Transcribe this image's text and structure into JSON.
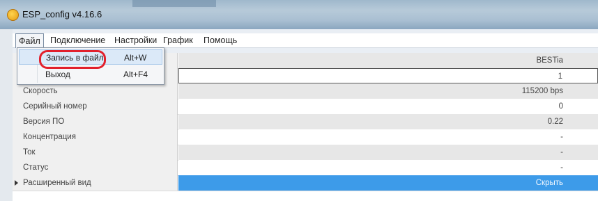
{
  "window": {
    "title": "ESP_config v4.16.6",
    "icon": "app-icon"
  },
  "menu": {
    "items": [
      "Файл",
      "Подключение",
      "Настройки",
      "График",
      "Помощь"
    ],
    "active": "Файл"
  },
  "file_menu": {
    "items": [
      {
        "label": "Запись в файл",
        "shortcut": "Alt+W"
      },
      {
        "label": "Выход",
        "shortcut": "Alt+F4"
      }
    ]
  },
  "grid": {
    "rows": [
      {
        "label": "",
        "value": "BESTia"
      },
      {
        "label": "",
        "value": "1"
      },
      {
        "label": "Скорость",
        "value": "115200 bps"
      },
      {
        "label": "Серийный номер",
        "value": "0"
      },
      {
        "label": "Версия ПО",
        "value": "0.22"
      },
      {
        "label": "Концентрация",
        "value": "-"
      },
      {
        "label": "Ток",
        "value": "-"
      },
      {
        "label": "Статус",
        "value": "-"
      },
      {
        "label": "Расширенный вид",
        "value": "Скрыть"
      }
    ]
  },
  "colors": {
    "highlight_ring": "#e2202c",
    "selected_cell": "#3d9be9"
  }
}
